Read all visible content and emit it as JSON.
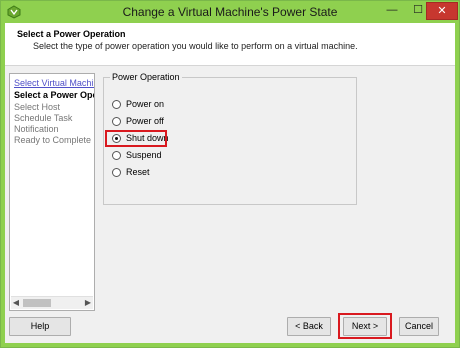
{
  "window": {
    "title": "Change a Virtual Machine's Power State",
    "min_icon": "minimize-icon",
    "max_icon": "maximize-icon",
    "close_icon": "close-icon",
    "app_icon": "vsphere-app-icon",
    "min_glyph": "—",
    "max_glyph": "☐",
    "close_glyph": "✕"
  },
  "header": {
    "title": "Select a Power Operation",
    "subtitle": "Select the type of power operation you would like to perform on a virtual machine."
  },
  "nav": {
    "items": [
      {
        "label": "Select Virtual Machine"
      },
      {
        "label": "Select a Power Operation"
      },
      {
        "label": "Select Host"
      },
      {
        "label": "Schedule Task"
      },
      {
        "label": "Notification"
      },
      {
        "label": "Ready to Complete"
      }
    ],
    "scroll_left": "◀",
    "scroll_right": "▶"
  },
  "power_operation": {
    "legend": "Power Operation",
    "options": [
      {
        "label": "Power on",
        "checked": false
      },
      {
        "label": "Power off",
        "checked": false
      },
      {
        "label": "Shut down",
        "checked": true
      },
      {
        "label": "Suspend",
        "checked": false
      },
      {
        "label": "Reset",
        "checked": false
      }
    ]
  },
  "buttons": {
    "help": "Help",
    "back": "< Back",
    "next": "Next >",
    "cancel": "Cancel"
  },
  "colors": {
    "titlebar": "#8fd04f",
    "highlight": "#d9191f",
    "close": "#c7372f"
  }
}
